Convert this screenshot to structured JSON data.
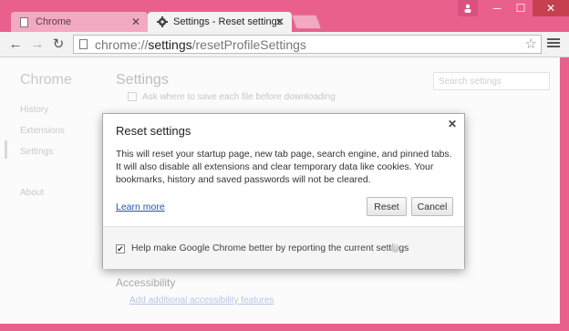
{
  "tabs": [
    {
      "label": "Chrome",
      "active": false
    },
    {
      "label": "Settings - Reset settings",
      "active": true
    }
  ],
  "toolbar": {
    "url_scheme": "chrome://",
    "url_host": "settings",
    "url_path": "/resetProfileSettings"
  },
  "sidebar": {
    "title": "Chrome",
    "items": [
      {
        "label": "History"
      },
      {
        "label": "Extensions"
      },
      {
        "label": "Settings"
      },
      {
        "label": "About"
      }
    ]
  },
  "main": {
    "title": "Settings",
    "search_placeholder": "Search settings",
    "download_row": "Ask where to save each file before downloading",
    "accessibility_heading": "Accessibility",
    "accessibility_link": "Add additional accessibility features"
  },
  "dialog": {
    "title": "Reset settings",
    "body": "This will reset your startup page, new tab page, search engine, and pinned tabs. It will also disable all extensions and clear temporary data like cookies. Your bookmarks, history and saved passwords will not be cleared.",
    "learn_more": "Learn more",
    "reset_label": "Reset",
    "cancel_label": "Cancel",
    "report_label": "Help make Google Chrome better by reporting the current settings",
    "report_checked": true
  },
  "colors": {
    "frame": "#e9608d",
    "link": "#2255aa"
  }
}
